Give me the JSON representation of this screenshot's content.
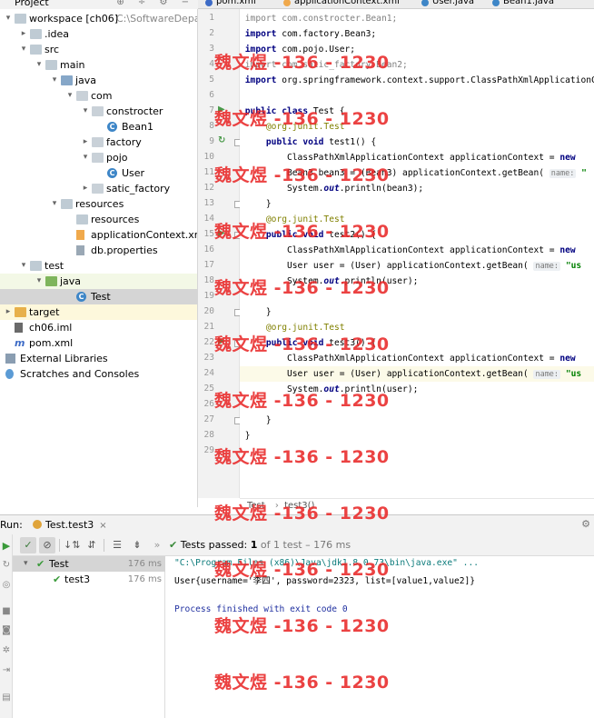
{
  "project_panel": {
    "title": "Project",
    "tree": [
      {
        "label": "workspace [ch06]",
        "extra": "C:\\SoftwareDepartment\\",
        "indent": 0,
        "arrow": "down",
        "icon": "folder"
      },
      {
        "label": ".idea",
        "indent": 1,
        "arrow": "right",
        "icon": "folder"
      },
      {
        "label": "src",
        "indent": 1,
        "arrow": "down",
        "icon": "folder"
      },
      {
        "label": "main",
        "indent": 2,
        "arrow": "down",
        "icon": "folder"
      },
      {
        "label": "java",
        "indent": 3,
        "arrow": "down",
        "icon": "folder-blue"
      },
      {
        "label": "com",
        "indent": 4,
        "arrow": "down",
        "icon": "pkg"
      },
      {
        "label": "constrocter",
        "indent": 5,
        "arrow": "down",
        "icon": "pkg"
      },
      {
        "label": "Bean1",
        "indent": 6,
        "arrow": "",
        "icon": "class"
      },
      {
        "label": "factory",
        "indent": 5,
        "arrow": "right",
        "icon": "pkg"
      },
      {
        "label": "pojo",
        "indent": 5,
        "arrow": "down",
        "icon": "pkg"
      },
      {
        "label": "User",
        "indent": 6,
        "arrow": "",
        "icon": "class"
      },
      {
        "label": "satic_factory",
        "indent": 5,
        "arrow": "right",
        "icon": "pkg"
      },
      {
        "label": "resources",
        "indent": 3,
        "arrow": "down",
        "icon": "folder"
      },
      {
        "label": "resources",
        "indent": 4,
        "arrow": "",
        "icon": "folder"
      },
      {
        "label": "applicationContext.xml",
        "indent": 4,
        "arrow": "",
        "icon": "xml"
      },
      {
        "label": "db.properties",
        "indent": 4,
        "arrow": "",
        "icon": "props"
      },
      {
        "label": "test",
        "indent": 1,
        "arrow": "down",
        "icon": "folder"
      },
      {
        "label": "java",
        "indent": 2,
        "arrow": "down",
        "icon": "folder-green",
        "highlight": "green"
      },
      {
        "label": "Test",
        "indent": 4,
        "arrow": "",
        "icon": "class",
        "highlight": "selected"
      },
      {
        "label": "target",
        "indent": 0,
        "arrow": "right",
        "icon": "folder-orange",
        "highlight": "yellow"
      },
      {
        "label": "ch06.iml",
        "indent": 0,
        "arrow": "",
        "icon": "iml"
      },
      {
        "label": "pom.xml",
        "indent": 0,
        "arrow": "",
        "icon": "maven"
      },
      {
        "label": "External Libraries",
        "indent": -1,
        "arrow": "",
        "icon": "ext"
      },
      {
        "label": "Scratches and Consoles",
        "indent": -1,
        "arrow": "",
        "icon": "scratch"
      }
    ]
  },
  "editor": {
    "tabs": [
      "pom.xml",
      "applicationContext.xml",
      "User.java",
      "Bean1.java"
    ],
    "current_line": 24,
    "lines": [
      {
        "n": 1,
        "html": "<span class='unused'>import com.constrocter.Bean1;</span>"
      },
      {
        "n": 2,
        "html": "<span class='kw'>import</span> com.factory.Bean3;"
      },
      {
        "n": 3,
        "html": "<span class='kw'>import</span> com.pojo.User;"
      },
      {
        "n": 4,
        "html": "<span class='unused'>import com.satic_factory.Bean2;</span>"
      },
      {
        "n": 5,
        "html": "<span class='kw'>import</span> org.springframework.context.support.ClassPathXmlApplicationContext;"
      },
      {
        "n": 6,
        "html": ""
      },
      {
        "n": 7,
        "html": "<span class='kw'>public class</span> Test {"
      },
      {
        "n": 8,
        "html": "    <span class='ann'>@org.junit.Test</span>"
      },
      {
        "n": 9,
        "html": "    <span class='kw'>public void</span> test1() {"
      },
      {
        "n": 10,
        "html": "        ClassPathXmlApplicationContext applicationContext = <span class='kw'>new</span>"
      },
      {
        "n": 11,
        "html": "        Bean3 bean3 = (Bean3) applicationContext.getBean( <span class='hint'>name:</span> <span class='str'>\"</span>"
      },
      {
        "n": 12,
        "html": "        System.<span class='italic kw'>out</span>.println(bean3);"
      },
      {
        "n": 13,
        "html": "    }"
      },
      {
        "n": 14,
        "html": "    <span class='ann'>@org.junit.Test</span>"
      },
      {
        "n": 15,
        "html": "    <span class='kw'>public void</span> test2() {"
      },
      {
        "n": 16,
        "html": "        ClassPathXmlApplicationContext applicationContext = <span class='kw'>new</span>"
      },
      {
        "n": 17,
        "html": "        User user = (User) applicationContext.getBean( <span class='hint'>name:</span> <span class='str'>\"us</span>"
      },
      {
        "n": 18,
        "html": "        System.<span class='italic kw'>out</span>.println(user);"
      },
      {
        "n": 19,
        "html": ""
      },
      {
        "n": 20,
        "html": "    }"
      },
      {
        "n": 21,
        "html": "    <span class='ann'>@org.junit.Test</span>"
      },
      {
        "n": 22,
        "html": "    <span class='kw'>public void</span> test3() {"
      },
      {
        "n": 23,
        "html": "        ClassPathXmlApplicationContext applicationContext = <span class='kw'>new</span>"
      },
      {
        "n": 24,
        "html": "        User user = (User) applicationContext.getBean( <span class='hint'>name:</span> <span class='str'>\"us</span>"
      },
      {
        "n": 25,
        "html": "        System.<span class='italic kw'>out</span>.println(user);"
      },
      {
        "n": 26,
        "html": ""
      },
      {
        "n": 27,
        "html": "    }"
      },
      {
        "n": 28,
        "html": "}"
      },
      {
        "n": 29,
        "html": ""
      }
    ],
    "breadcrumb": [
      "Test",
      "test3()"
    ]
  },
  "run_panel": {
    "label": "Run:",
    "tab": "Test.test3",
    "status_prefix": "Tests passed:",
    "status_count": "1",
    "status_rest": "of 1 test – 176 ms",
    "tests": [
      {
        "name": "Test",
        "time": "176 ms"
      },
      {
        "name": "test3",
        "time": "176 ms"
      }
    ],
    "console": [
      {
        "text": "\"C:\\Program Files (x86)\\Java\\jdk1.8.0_73\\bin\\java.exe\" ...",
        "kind": "cmd"
      },
      {
        "text": "User{username='李四', password=2323, list=[value1,value2]}",
        "kind": "out"
      },
      {
        "text": "",
        "kind": "out"
      },
      {
        "text": "Process finished with exit code 0",
        "kind": "fin"
      }
    ]
  },
  "watermark": "魏文煜 -136 - 1230"
}
